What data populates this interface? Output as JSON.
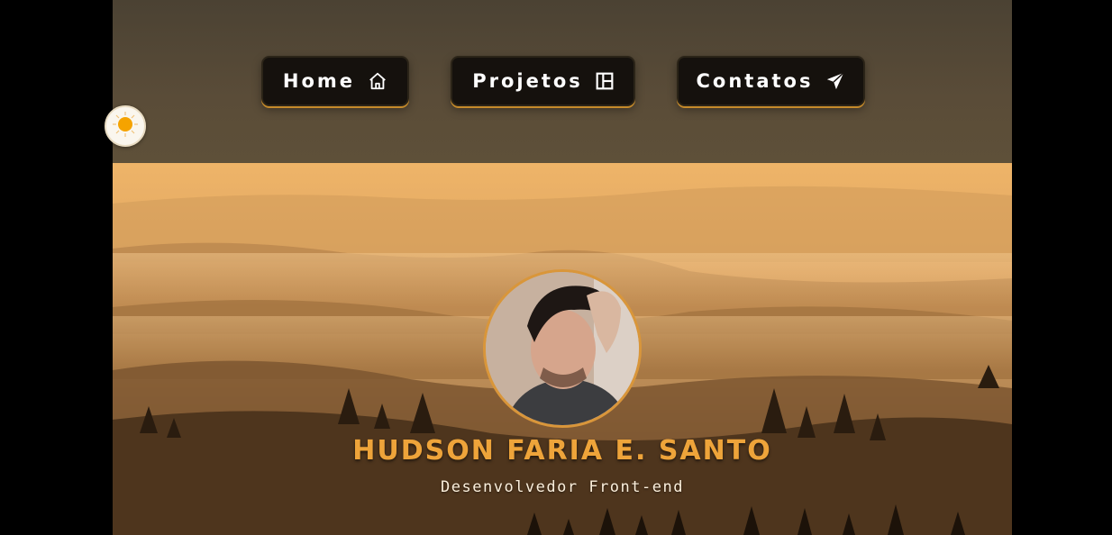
{
  "nav": {
    "home_label": "Home",
    "projects_label": "Projetos",
    "contacts_label": "Contatos"
  },
  "theme_toggle": {
    "icon": "sun-icon"
  },
  "hero": {
    "name": "HUDSON FARIA E. SANTO",
    "role": "Desenvolvedor Front-end",
    "avatar": "profile-photo"
  },
  "colors": {
    "header_bg": "#5a4c38",
    "button_bg": "#15110d",
    "button_glow": "#c58a2a",
    "name_color": "#eea43a",
    "avatar_border": "#d9963a"
  }
}
